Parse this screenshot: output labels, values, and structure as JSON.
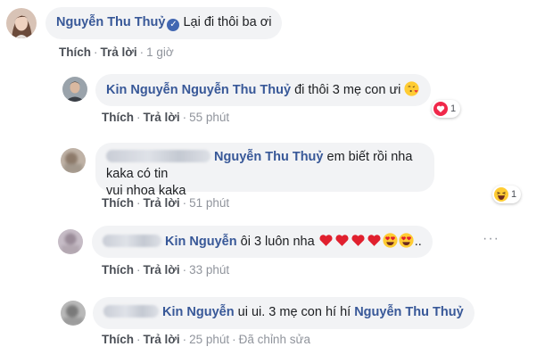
{
  "comments": [
    {
      "author": "Nguyễn Thu Thuỷ",
      "verified_icon": "verified-badge-icon",
      "text": "Lại đi thôi ba ơi",
      "like": "Thích",
      "reply": "Trả lời",
      "time": "1 giờ"
    },
    {
      "author": "Kin Nguyễn",
      "tag": "Nguyễn Thu Thuỷ",
      "text": "đi thôi 3 mẹ con ưi",
      "emoji": "face-blowing-kiss-emoji",
      "reaction_icon": "love-reaction-icon",
      "reaction_count": "1",
      "like": "Thích",
      "reply": "Trả lời",
      "time": "55 phút"
    },
    {
      "tag": "Nguyễn Thu Thuỷ",
      "text_line1": "em biết rồi nha kaka có tin",
      "text_line2": "vui nhoa kaka",
      "reaction_icon": "haha-reaction-icon",
      "reaction_count": "1",
      "like": "Thích",
      "reply": "Trả lời",
      "time": "51 phút"
    },
    {
      "tag": "Kin Nguyễn",
      "text": "ôi 3 luôn nha",
      "emojis": [
        "red-heart-emoji",
        "red-heart-emoji",
        "red-heart-emoji",
        "red-heart-emoji",
        "heart-eyes-emoji",
        "heart-eyes-emoji"
      ],
      "suffix": "..",
      "more_icon": "more-options-icon",
      "like": "Thích",
      "reply": "Trả lời",
      "time": "33 phút"
    },
    {
      "tag": "Kin Nguyễn",
      "text": "ui ui. 3 mẹ con hí hí",
      "tag2": "Nguyễn Thu Thuỷ",
      "like": "Thích",
      "reply": "Trả lời",
      "time": "25 phút",
      "edited": "Đã chỉnh sửa"
    }
  ],
  "colors": {
    "link": "#385898",
    "bubble": "#f2f3f5",
    "meta": "#90949c",
    "verified": "#4267b2"
  }
}
